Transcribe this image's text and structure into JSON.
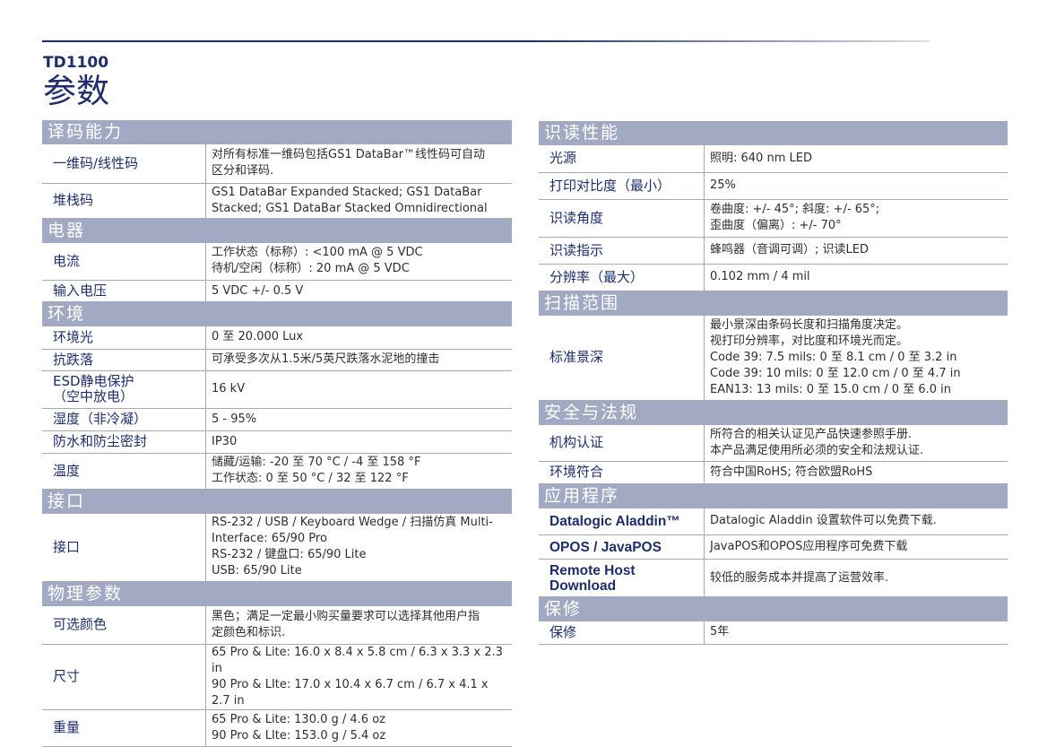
{
  "header": {
    "model": "TD1100",
    "title": "参数"
  },
  "left": {
    "decode": {
      "heading": "译码能力",
      "rows": [
        {
          "label": "一维码/线性码",
          "value": "对所有标准一维码包括GS1 DataBar™线性码可自动\n区分和译码."
        },
        {
          "label": "堆栈码",
          "value": "GS1 DataBar Expanded Stacked; GS1 DataBar\nStacked; GS1 DataBar Stacked Omnidirectional"
        }
      ]
    },
    "electrical": {
      "heading": "电器",
      "rows": [
        {
          "label": "电流",
          "value": "工作状态（标称）: <100 mA @ 5 VDC\n待机/空闲（标称）: 20 mA @ 5 VDC"
        },
        {
          "label": "输入电压",
          "value": "5 VDC +/- 0.5 V"
        }
      ]
    },
    "environment": {
      "heading": "环境",
      "rows": [
        {
          "label": "环境光",
          "value": "0 至 20.000 Lux"
        },
        {
          "label": "抗跌落",
          "value": "可承受多次从1.5米/5英尺跌落水泥地的撞击"
        },
        {
          "label": "ESD静电保护",
          "label2": "（空中放电）",
          "value": "16 kV"
        },
        {
          "label": "湿度（非冷凝）",
          "value": "5 - 95%"
        },
        {
          "label": "防水和防尘密封",
          "value": "IP30"
        },
        {
          "label": "温度",
          "value": "储藏/运输: -20 至 70 °C / -4 至 158 °F\n工作状态: 0 至 50 °C / 32 至 122 °F"
        }
      ]
    },
    "interface": {
      "heading": "接口",
      "rows": [
        {
          "label": "接口",
          "value": "RS-232 / USB / Keyboard Wedge / 扫描仿真 Multi-\nInterface: 65/90 Pro\nRS-232 / 键盘口: 65/90 Lite\nUSB: 65/90 Lite"
        }
      ]
    },
    "physical": {
      "heading": "物理参数",
      "rows": [
        {
          "label": "可选颜色",
          "value": "黑色；满足一定最小购买量要求可以选择其他用户指\n定颜色和标识."
        },
        {
          "label": "尺寸",
          "value": "65 Pro & Lite: 16.0 x 8.4 x 5.8 cm / 6.3 x 3.3 x 2.3 in\n90 Pro & LIte: 17.0 x 10.4 x 6.7 cm / 6.7 x 4.1 x 2.7 in"
        },
        {
          "label": "重量",
          "value": "65 Pro & Lite: 130.0 g / 4.6 oz\n90 Pro & LIte: 153.0 g / 5.4 oz"
        }
      ]
    }
  },
  "right": {
    "reading": {
      "heading": "识读性能",
      "rows": [
        {
          "label": "光源",
          "value": "照明: 640 nm LED"
        },
        {
          "label": "打印对比度（最小）",
          "value": "25%"
        },
        {
          "label": "识读角度",
          "value": "卷曲度: +/- 45°; 斜度: +/- 65°;\n歪曲度（偏离）: +/- 70°"
        },
        {
          "label": "识读指示",
          "value": "蜂鸣器（音调可调）; 识读LED"
        },
        {
          "label": "分辨率（最大）",
          "value": "0.102 mm / 4 mil"
        }
      ]
    },
    "scan_range": {
      "heading": "扫描范围",
      "rows": [
        {
          "label": "标准景深",
          "value": "最小景深由条码长度和扫描角度决定。\n视打印分辨率，对比度和环境光而定。\nCode 39: 7.5 mils: 0 至 8.1 cm / 0 至 3.2 in\nCode 39: 10 mils: 0 至 12.0 cm / 0 至 4.7 in\nEAN13: 13 mils: 0 至 15.0 cm / 0 至 6.0 in"
        }
      ]
    },
    "safety": {
      "heading": "安全与法规",
      "rows": [
        {
          "label": "机构认证",
          "value": "所符合的相关认证见产品快速参照手册.\n本产品满足使用所必须的安全和法规认证."
        },
        {
          "label": "环境符合",
          "value": "符合中国RoHS; 符合欧盟RoHS"
        }
      ]
    },
    "applications": {
      "heading": "应用程序",
      "rows": [
        {
          "label": "Datalogic Aladdin™",
          "value": "Datalogic Aladdin 设置软件可以免费下载."
        },
        {
          "label": "OPOS / JavaPOS",
          "value": "JavaPOS和OPOS应用程序可免费下载"
        },
        {
          "label": "Remote Host",
          "label2": "Download",
          "value": "较低的服务成本并提高了运营效率."
        }
      ]
    },
    "warranty": {
      "heading": "保修",
      "rows": [
        {
          "label": "保修",
          "value": "5年"
        }
      ]
    }
  }
}
